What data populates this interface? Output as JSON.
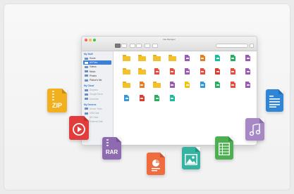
{
  "window": {
    "title": "File Manager",
    "traffic_lights": {
      "close": "#fc605c",
      "minimize": "#fdbc40",
      "zoom": "#34c84a"
    }
  },
  "sidebar": {
    "sections": [
      {
        "title": "My Stuff",
        "items": [
          {
            "label": "Home",
            "icon": "home-icon",
            "selected": false
          },
          {
            "label": "All Files",
            "icon": "folder-icon",
            "selected": true
          },
          {
            "label": "Videos",
            "icon": "video-icon",
            "selected": false
          },
          {
            "label": "Music",
            "icon": "music-icon",
            "selected": false
          },
          {
            "label": "Photos",
            "icon": "photo-icon",
            "selected": false
          },
          {
            "label": "Picture's Me",
            "icon": "image-icon",
            "selected": false
          }
        ]
      },
      {
        "title": "My Cloud",
        "items": [
          {
            "label": "Dropbox",
            "icon": "cloud-icon",
            "selected": false
          },
          {
            "label": "Google Drive",
            "icon": "drive-icon",
            "selected": false
          },
          {
            "label": "Onedrive",
            "icon": "cloud-icon",
            "selected": false
          }
        ]
      },
      {
        "title": "My Devices",
        "items": [
          {
            "label": "Server Tools",
            "icon": "server-icon",
            "selected": false
          },
          {
            "label": "USB Disk",
            "icon": "usb-icon",
            "selected": false
          },
          {
            "label": "SD Card",
            "icon": "sd-card-icon",
            "selected": false
          },
          {
            "label": "External Disk",
            "icon": "disk-icon",
            "selected": false
          }
        ]
      }
    ]
  },
  "file_grid": [
    [
      "folder",
      "folder",
      "folder",
      "folder",
      "doc-purple",
      "doc-orange",
      "doc-teal",
      "doc-green",
      "doc-purple"
    ],
    [
      "folder",
      "folder",
      "doc-red",
      "doc-red",
      "doc-purple",
      "doc-red",
      "doc-pdf",
      "doc-red",
      "doc-purple"
    ],
    [
      "folder",
      "doc-orange",
      "folder",
      "doc-purple",
      "doc-yellow",
      "doc-blue",
      "doc-green",
      "doc-red",
      "doc-purple"
    ],
    [
      "doc-blue",
      "doc-pdf",
      "doc-green",
      "doc-teal"
    ]
  ],
  "file_colors": {
    "folder": "#f5c02e",
    "doc-purple": "#9b59b6",
    "doc-orange": "#e67e22",
    "doc-teal": "#1abc9c",
    "doc-green": "#27ae60",
    "doc-red": "#e74c3c",
    "doc-pdf": "#e03a2f",
    "doc-yellow": "#f1c40f",
    "doc-blue": "#3498db"
  },
  "floating_icons": {
    "zip": {
      "label": "ZIP",
      "color": "#f2b01e"
    },
    "video": {
      "label": "",
      "color": "#e23d3d"
    },
    "rar": {
      "label": "RAR",
      "color": "#8e6bb0"
    },
    "presentation": {
      "label": "",
      "color": "#ef6c3f"
    },
    "image": {
      "label": "",
      "color": "#34b3a0"
    },
    "spreadsheet": {
      "label": "",
      "color": "#4caf50"
    },
    "audio": {
      "label": "",
      "color": "#a688c4"
    },
    "document": {
      "label": "",
      "color": "#2f86d6"
    }
  }
}
